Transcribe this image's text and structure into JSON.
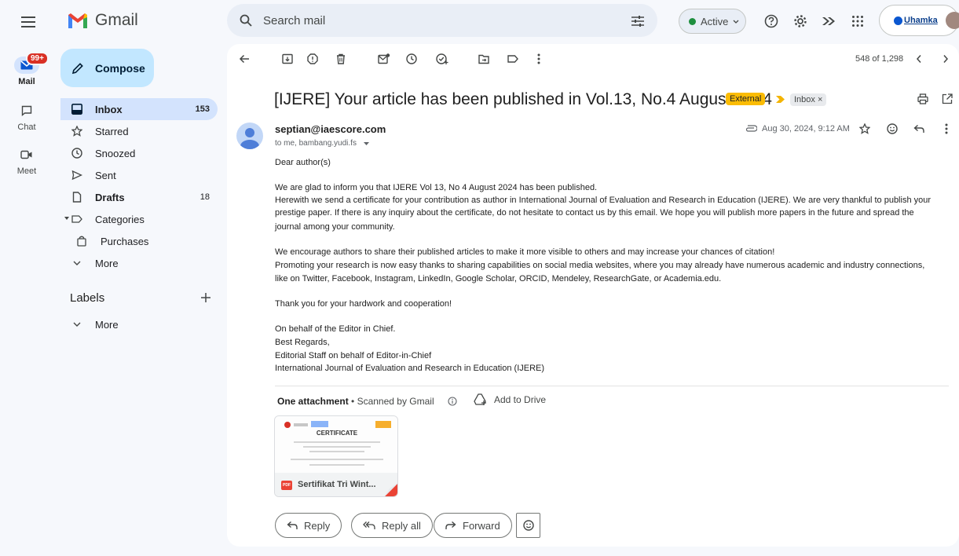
{
  "app": {
    "name": "Gmail"
  },
  "rail": {
    "mail_label": "Mail",
    "mail_badge": "99+",
    "chat_label": "Chat",
    "meet_label": "Meet"
  },
  "search": {
    "placeholder": "Search mail"
  },
  "status": {
    "label": "Active"
  },
  "account": {
    "org_label": "Uhamka"
  },
  "sidebar": {
    "compose": "Compose",
    "items": [
      {
        "label": "Inbox",
        "count": "153"
      },
      {
        "label": "Starred",
        "count": ""
      },
      {
        "label": "Snoozed",
        "count": ""
      },
      {
        "label": "Sent",
        "count": ""
      },
      {
        "label": "Drafts",
        "count": "18"
      },
      {
        "label": "Categories",
        "count": ""
      },
      {
        "label": "Purchases",
        "count": ""
      },
      {
        "label": "More",
        "count": ""
      }
    ],
    "labels_heading": "Labels",
    "labels_more": "More"
  },
  "toolbar": {
    "pagination": "548 of 1,298"
  },
  "email": {
    "subject": "[IJERE] Your article has been published in Vol.13, No.4 August 2024",
    "tag_external": "External",
    "tag_inbox": "Inbox ×",
    "sender": "septian@iaescore.com",
    "recipients": "to me, bambang.yudi.fs",
    "date": "Aug 30, 2024, 9:12 AM",
    "body": [
      "Dear author(s)",
      "",
      "We are glad to inform you that IJERE Vol 13, No 4 August 2024 has been published.",
      "Herewith we send a certificate for your contribution as author in International Journal of Evaluation and Research in Education (IJERE). We are very thankful to publish your",
      "prestige paper. If there is any inquiry about the certificate, do not hesitate to contact us by this email. We hope you will publish more papers in the future and spread the",
      "journal among your community.",
      "",
      "We encourage authors to share their published articles to make it more visible to others and may increase your chances of citation!",
      "Promoting your research is now easy thanks to sharing capabilities on social media websites, where you may already have numerous academic and industry connections,",
      "like on Twitter, Facebook, Instagram, LinkedIn, Google Scholar, ORCID, Mendeley, ResearchGate, or Academia.edu.",
      "",
      "Thank you for your hardwork and cooperation!",
      "",
      "On behalf of the Editor in Chief.",
      "Best Regards,",
      "Editorial Staff on behalf of Editor-in-Chief",
      "International Journal of Evaluation and Research in Education (IJERE)"
    ]
  },
  "attachment": {
    "heading": "One attachment",
    "scanned": "Scanned by Gmail",
    "add_to_drive": "Add to Drive",
    "thumb_title": "CERTIFICATE",
    "file_type": "PDF",
    "file_name": "Sertifikat Tri Wint..."
  },
  "actions": {
    "reply": "Reply",
    "reply_all": "Reply all",
    "forward": "Forward"
  },
  "colors": {
    "accent": "#0b57d0",
    "compose_bg": "#c2e7ff",
    "external_chip": "#fbbc04",
    "active_dot": "#1e8e3e"
  }
}
